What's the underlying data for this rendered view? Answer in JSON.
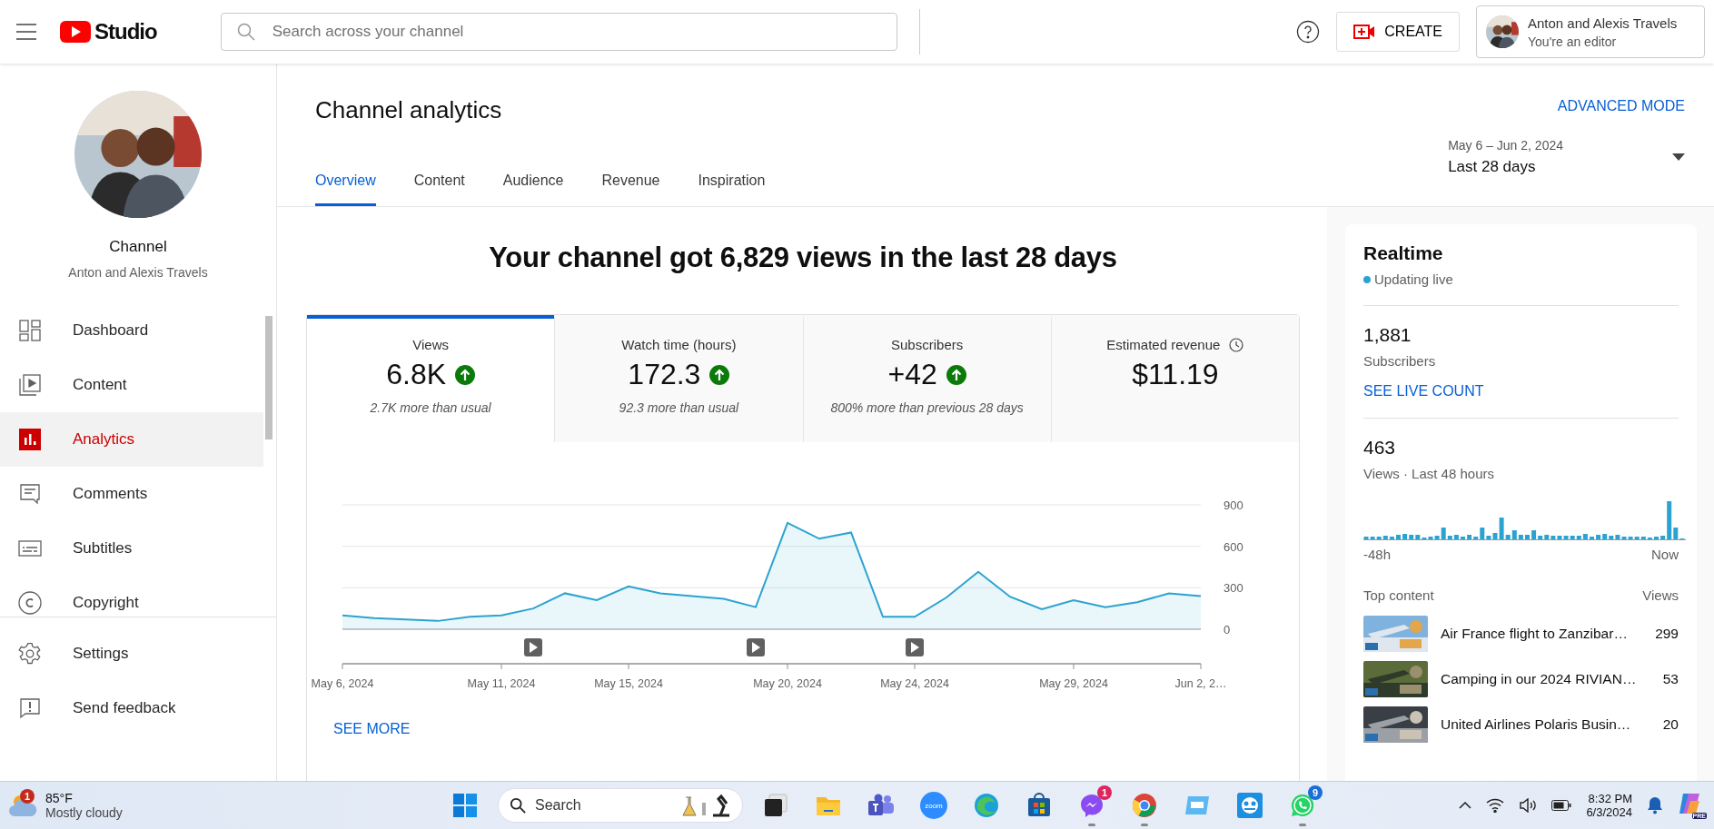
{
  "header": {
    "logo_text": "Studio",
    "search": {
      "placeholder": "Search across your channel"
    },
    "create_label": "CREATE",
    "account": {
      "name": "Anton and Alexis Travels",
      "role": "You're an editor"
    }
  },
  "sidebar": {
    "channel_label": "Channel",
    "channel_name": "Anton and Alexis Travels",
    "items": [
      {
        "label": "Dashboard",
        "kind": "dashboard",
        "selected": false
      },
      {
        "label": "Content",
        "kind": "content",
        "selected": false
      },
      {
        "label": "Analytics",
        "kind": "analytics",
        "selected": true
      },
      {
        "label": "Comments",
        "kind": "comments",
        "selected": false
      },
      {
        "label": "Subtitles",
        "kind": "subtitles",
        "selected": false
      },
      {
        "label": "Copyright",
        "kind": "copyright",
        "selected": false
      }
    ],
    "footer_items": [
      {
        "label": "Settings",
        "kind": "settings"
      },
      {
        "label": "Send feedback",
        "kind": "feedback"
      }
    ]
  },
  "page": {
    "title": "Channel analytics",
    "advanced_mode": "ADVANCED MODE",
    "tabs": [
      {
        "label": "Overview",
        "selected": true
      },
      {
        "label": "Content",
        "selected": false
      },
      {
        "label": "Audience",
        "selected": false
      },
      {
        "label": "Revenue",
        "selected": false
      },
      {
        "label": "Inspiration",
        "selected": false
      }
    ],
    "date_range": {
      "dates": "May 6 – Jun 2, 2024",
      "label": "Last 28 days"
    }
  },
  "overview": {
    "headline": "Your channel got 6,829 views in the last 28 days",
    "metrics": [
      {
        "label": "Views",
        "value": "6.8K",
        "up": true,
        "note": "2.7K more than usual",
        "delayed": false,
        "selected": true
      },
      {
        "label": "Watch time (hours)",
        "value": "172.3",
        "up": true,
        "note": "92.3 more than usual",
        "delayed": false,
        "selected": false
      },
      {
        "label": "Subscribers",
        "value": "+42",
        "up": true,
        "note": "800% more than previous 28 days",
        "delayed": false,
        "selected": false
      },
      {
        "label": "Estimated revenue",
        "value": "$11.19",
        "up": false,
        "delayed": true,
        "selected": false
      }
    ],
    "chart_data": {
      "type": "area",
      "categories": [
        "May 6, 2024",
        null,
        null,
        null,
        null,
        "May 11, 2024",
        null,
        null,
        null,
        "May 15, 2024",
        null,
        null,
        null,
        null,
        "May 20, 2024",
        null,
        null,
        null,
        "May 24, 2024",
        null,
        null,
        null,
        null,
        "May 29, 2024",
        null,
        null,
        null,
        "Jun 2, 2…"
      ],
      "series": [
        {
          "color": "#2ba3d0",
          "values": [
            100,
            80,
            70,
            60,
            90,
            100,
            150,
            260,
            210,
            310,
            260,
            240,
            220,
            160,
            770,
            655,
            700,
            90,
            90,
            230,
            415,
            235,
            145,
            210,
            160,
            195,
            260,
            240
          ]
        }
      ],
      "ylim": [
        0,
        900
      ],
      "yticks": [
        0,
        300,
        600,
        900
      ]
    },
    "see_more": "SEE MORE"
  },
  "realtime": {
    "title": "Realtime",
    "status": "Updating live",
    "subscribers": "1,881",
    "subscribers_label": "Subscribers",
    "live_count": "SEE LIVE COUNT",
    "views": "463",
    "views_label": "Views · Last 48 hours",
    "axis_start": "-48h",
    "axis_end": "Now",
    "top_label": "Top content",
    "views_col": "Views",
    "top_content": [
      {
        "title": "Air France flight to Zanzibar…",
        "views": "299",
        "kind": "picture"
      },
      {
        "title": "Camping in our 2024 RIVIAN…",
        "views": "53",
        "kind": "picture"
      },
      {
        "title": "United Airlines Polaris Busin…",
        "views": "20",
        "kind": "picture"
      }
    ]
  },
  "taskbar": {
    "weather": {
      "temp": "85°F",
      "condition": "Mostly cloudy",
      "badge": "1"
    },
    "search_label": "Search",
    "apps": [
      {
        "kind": "start",
        "running": false
      },
      {
        "kind": "taskview",
        "running": false
      },
      {
        "kind": "folder",
        "running": false
      },
      {
        "kind": "teams",
        "running": false
      },
      {
        "kind": "zoom",
        "label": "zoom",
        "running": false
      },
      {
        "kind": "edge",
        "running": false
      },
      {
        "kind": "store",
        "running": false
      },
      {
        "kind": "messenger",
        "badge": "1",
        "running": true
      },
      {
        "kind": "chrome",
        "running": true
      },
      {
        "kind": "window",
        "running": false
      },
      {
        "kind": "people",
        "running": false
      },
      {
        "kind": "whatsapp",
        "badge": "9",
        "running": true
      }
    ],
    "time": "8:32 PM",
    "date": "6/3/2024",
    "copilot_label": "PRE"
  }
}
